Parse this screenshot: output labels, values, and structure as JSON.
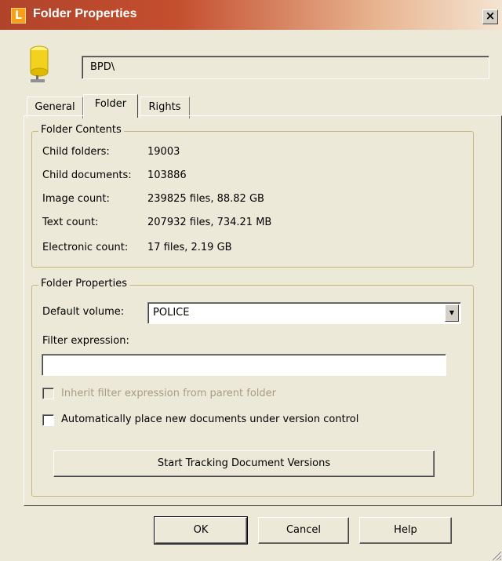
{
  "window": {
    "logo_letter": "L",
    "title": "Folder Properties",
    "close_glyph": "×"
  },
  "path_value": "BPD\\",
  "tabs": [
    {
      "label": "General",
      "active": false
    },
    {
      "label": "Folder",
      "active": true
    },
    {
      "label": "Rights",
      "active": false
    }
  ],
  "folder_contents": {
    "title": "Folder Contents",
    "rows": [
      {
        "label": "Child folders:",
        "value": "19003"
      },
      {
        "label": "Child documents:",
        "value": "103886"
      },
      {
        "label": "Image count:",
        "value": "239825 files, 88.82 GB"
      },
      {
        "label": "Text count:",
        "value": "207932 files, 734.21 MB"
      },
      {
        "label": "Electronic count:",
        "value": "17 files, 2.19 GB"
      }
    ]
  },
  "folder_properties": {
    "title": "Folder Properties",
    "default_volume_label": "Default volume:",
    "default_volume_value": "POLICE",
    "filter_label": "Filter expression:",
    "filter_value": "",
    "inherit_label": "Inherit filter expression from parent folder",
    "inherit_checked": false,
    "inherit_enabled": false,
    "auto_version_label": "Automatically place new documents under version control",
    "auto_version_checked": false,
    "start_tracking_label": "Start Tracking Document Versions"
  },
  "buttons": {
    "ok": "OK",
    "cancel": "Cancel",
    "help": "Help"
  },
  "icons": {
    "folder": "database-folder-icon",
    "dropdown": "chevron-down-icon",
    "grip": "resize-grip-icon"
  },
  "colors": {
    "title_start": "#B0442B",
    "title_end": "#F4E4D2",
    "dialog_bg": "#ECE9D8",
    "folder_icon": "#F2D21E",
    "disabled_text": "#A89C82"
  }
}
